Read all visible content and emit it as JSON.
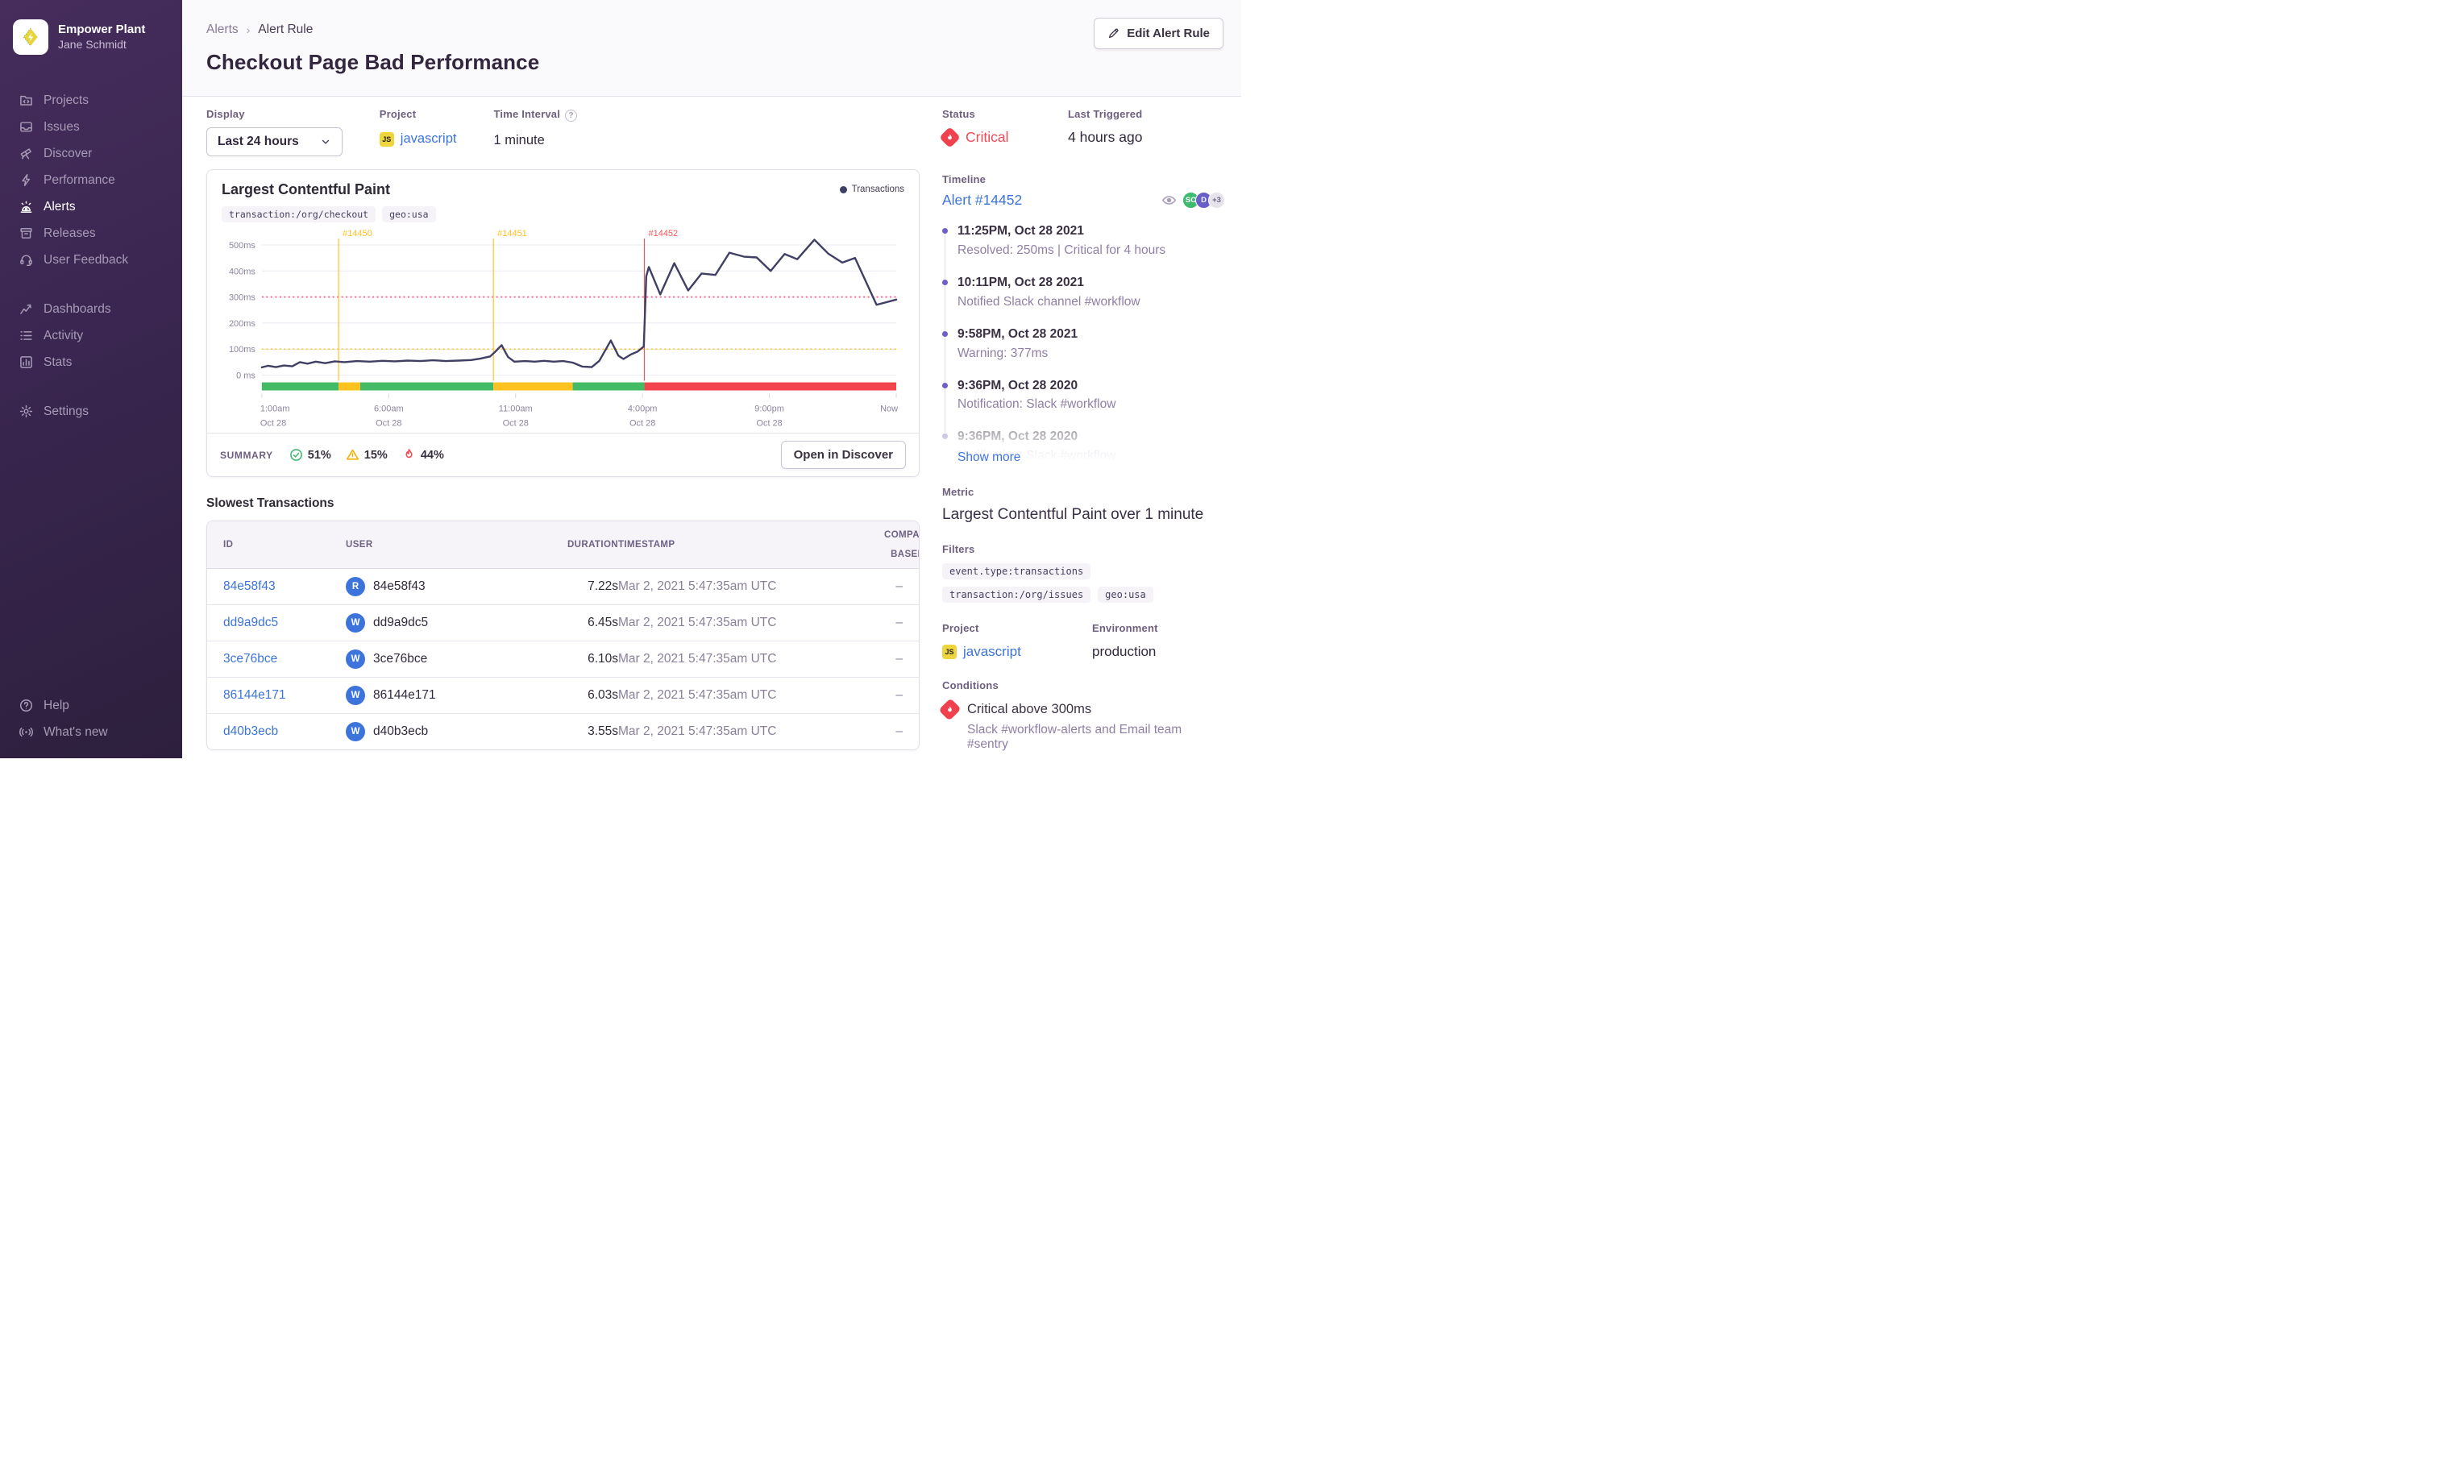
{
  "colors": {
    "ok": "#43ba64",
    "warning": "#fdc21f",
    "critical": "#f2454d",
    "line": "#3f3f63",
    "warning_line": "#ffc227",
    "critical_line": "#f55459",
    "threshold_critical": "#e9537e",
    "threshold_warning": "#ffc227",
    "grid": "#ece8f1",
    "axis": "#8d84a0",
    "accent_blue": "#3d74db",
    "status_red": "#f0414e"
  },
  "sidebar": {
    "org_name": "Empower Plant",
    "user_name": "Jane Schmidt",
    "sections": [
      {
        "name": "primary",
        "items": [
          {
            "label": "Projects",
            "icon": "projects"
          },
          {
            "label": "Issues",
            "icon": "issues"
          },
          {
            "label": "Discover",
            "icon": "discover"
          },
          {
            "label": "Performance",
            "icon": "performance"
          },
          {
            "label": "Alerts",
            "icon": "alerts",
            "active": true
          },
          {
            "label": "Releases",
            "icon": "releases"
          },
          {
            "label": "User Feedback",
            "icon": "user-feedback"
          }
        ]
      },
      {
        "name": "secondary",
        "items": [
          {
            "label": "Dashboards",
            "icon": "dashboards"
          },
          {
            "label": "Activity",
            "icon": "activity"
          },
          {
            "label": "Stats",
            "icon": "stats"
          }
        ]
      },
      {
        "name": "settings",
        "items": [
          {
            "label": "Settings",
            "icon": "settings"
          }
        ]
      }
    ],
    "footer_items": [
      {
        "label": "Help",
        "icon": "help"
      },
      {
        "label": "What's new",
        "icon": "whats-new"
      }
    ]
  },
  "header": {
    "breadcrumb_root": "Alerts",
    "breadcrumb_current": "Alert Rule",
    "title": "Checkout Page Bad Performance",
    "edit_button": "Edit Alert Rule"
  },
  "controls": {
    "display": {
      "label": "Display",
      "value": "Last 24 hours"
    },
    "project": {
      "label": "Project",
      "value": "javascript",
      "platform": "JS"
    },
    "interval": {
      "label": "Time Interval",
      "value": "1 minute"
    }
  },
  "status_panel": {
    "status_label": "Status",
    "status_value": "Critical",
    "last_triggered_label": "Last Triggered",
    "last_triggered_value": "4 hours ago"
  },
  "chart_card": {
    "title": "Largest Contentful Paint",
    "tags": [
      "transaction:/org/checkout",
      "geo:usa"
    ],
    "legend_label": "Transactions",
    "summary_label": "SUMMARY",
    "summary": [
      {
        "icon": "check-circle",
        "value": "51%"
      },
      {
        "icon": "warning-triangle",
        "value": "15%"
      },
      {
        "icon": "fire",
        "value": "44%"
      }
    ],
    "discover_button": "Open in Discover"
  },
  "chart_data": {
    "type": "line",
    "title": "Largest Contentful Paint",
    "unit": "ms",
    "ylim": [
      0,
      500
    ],
    "grid": true,
    "legend": {
      "position": "top-right",
      "entries": [
        "Transactions"
      ]
    },
    "y_ticks": [
      {
        "value": 0,
        "label": "0 ms"
      },
      {
        "value": 100,
        "label": "100ms"
      },
      {
        "value": 200,
        "label": "200ms"
      },
      {
        "value": 300,
        "label": "300ms"
      },
      {
        "value": 400,
        "label": "400ms"
      },
      {
        "value": 500,
        "label": "500ms"
      }
    ],
    "x_ticks": [
      {
        "pos": 0,
        "time": "1:00am",
        "date": "Oct 28"
      },
      {
        "pos": 0.2,
        "time": "6:00am",
        "date": "Oct 28"
      },
      {
        "pos": 0.4,
        "time": "11:00am",
        "date": "Oct 28"
      },
      {
        "pos": 0.6,
        "time": "4:00pm",
        "date": "Oct 28"
      },
      {
        "pos": 0.8,
        "time": "9:00pm",
        "date": "Oct 28"
      },
      {
        "pos": 1,
        "time": "Now",
        "date": ""
      }
    ],
    "thresholds": [
      {
        "label": "critical",
        "value": 300
      },
      {
        "label": "warning",
        "value": 100
      }
    ],
    "incidents": [
      {
        "id": "#14450",
        "pos": 0.121,
        "severity": "warning"
      },
      {
        "id": "#14451",
        "pos": 0.365,
        "severity": "warning"
      },
      {
        "id": "#14452",
        "pos": 0.603,
        "severity": "critical"
      }
    ],
    "status_segments": [
      {
        "from": 0,
        "to": 0.121,
        "status": "ok"
      },
      {
        "from": 0.121,
        "to": 0.155,
        "status": "warning"
      },
      {
        "from": 0.155,
        "to": 0.365,
        "status": "ok"
      },
      {
        "from": 0.365,
        "to": 0.49,
        "status": "warning"
      },
      {
        "from": 0.49,
        "to": 0.603,
        "status": "ok"
      },
      {
        "from": 0.603,
        "to": 1,
        "status": "critical"
      }
    ],
    "series": [
      {
        "name": "Transactions",
        "points": [
          [
            0,
            30
          ],
          [
            0.01,
            36
          ],
          [
            0.022,
            31
          ],
          [
            0.035,
            37
          ],
          [
            0.048,
            34
          ],
          [
            0.06,
            50
          ],
          [
            0.072,
            44
          ],
          [
            0.085,
            52
          ],
          [
            0.1,
            46
          ],
          [
            0.115,
            53
          ],
          [
            0.13,
            50
          ],
          [
            0.15,
            54
          ],
          [
            0.17,
            52
          ],
          [
            0.19,
            55
          ],
          [
            0.21,
            53
          ],
          [
            0.23,
            56
          ],
          [
            0.25,
            54
          ],
          [
            0.27,
            57
          ],
          [
            0.29,
            54
          ],
          [
            0.31,
            56
          ],
          [
            0.33,
            58
          ],
          [
            0.345,
            64
          ],
          [
            0.36,
            72
          ],
          [
            0.37,
            95
          ],
          [
            0.378,
            115
          ],
          [
            0.388,
            70
          ],
          [
            0.398,
            52
          ],
          [
            0.415,
            54
          ],
          [
            0.43,
            52
          ],
          [
            0.445,
            55
          ],
          [
            0.46,
            52
          ],
          [
            0.475,
            54
          ],
          [
            0.49,
            48
          ],
          [
            0.505,
            33
          ],
          [
            0.52,
            31
          ],
          [
            0.532,
            55
          ],
          [
            0.55,
            133
          ],
          [
            0.562,
            75
          ],
          [
            0.57,
            62
          ],
          [
            0.582,
            80
          ],
          [
            0.592,
            90
          ],
          [
            0.602,
            110
          ],
          [
            0.606,
            380
          ],
          [
            0.61,
            415
          ],
          [
            0.628,
            310
          ],
          [
            0.65,
            430
          ],
          [
            0.672,
            325
          ],
          [
            0.693,
            390
          ],
          [
            0.715,
            385
          ],
          [
            0.737,
            470
          ],
          [
            0.76,
            455
          ],
          [
            0.78,
            452
          ],
          [
            0.802,
            400
          ],
          [
            0.824,
            465
          ],
          [
            0.844,
            445
          ],
          [
            0.871,
            520
          ],
          [
            0.893,
            466
          ],
          [
            0.915,
            432
          ],
          [
            0.935,
            450
          ],
          [
            0.969,
            270
          ],
          [
            1,
            290
          ]
        ]
      }
    ]
  },
  "transactions_table": {
    "title": "Slowest Transactions",
    "columns": [
      "ID",
      "USER",
      "DURATION",
      "TIMESTAMP",
      "COMPARED TO BASELINE"
    ],
    "rows": [
      {
        "id": "84e58f43",
        "avatar": "R",
        "user": "84e58f43",
        "duration": "7.22s",
        "timestamp": "Mar 2, 2021 5:47:35am UTC",
        "baseline": "–"
      },
      {
        "id": "dd9a9dc5",
        "avatar": "W",
        "user": "dd9a9dc5",
        "duration": "6.45s",
        "timestamp": "Mar 2, 2021 5:47:35am UTC",
        "baseline": "–"
      },
      {
        "id": "3ce76bce",
        "avatar": "W",
        "user": "3ce76bce",
        "duration": "6.10s",
        "timestamp": "Mar 2, 2021 5:47:35am UTC",
        "baseline": "–"
      },
      {
        "id": "86144e171",
        "avatar": "W",
        "user": "86144e171",
        "duration": "6.03s",
        "timestamp": "Mar 2, 2021 5:47:35am UTC",
        "baseline": "–"
      },
      {
        "id": "d40b3ecb",
        "avatar": "W",
        "user": "d40b3ecb",
        "duration": "3.55s",
        "timestamp": "Mar 2, 2021 5:47:35am UTC",
        "baseline": "–"
      }
    ]
  },
  "timeline": {
    "label": "Timeline",
    "alert_link": "Alert #14452",
    "watchers": {
      "avatars": [
        "SC",
        "D"
      ],
      "more": "+3"
    },
    "entries": [
      {
        "time": "11:25PM, Oct 28 2021",
        "desc": "Resolved: 250ms | Critical for 4 hours"
      },
      {
        "time": "10:11PM, Oct 28 2021",
        "desc": "Notified Slack channel #workflow"
      },
      {
        "time": "9:58PM, Oct 28 2021",
        "desc": "Warning: 377ms"
      },
      {
        "time": "9:36PM, Oct 28 2020",
        "desc": "Notification: Slack #workflow"
      },
      {
        "time": "9:36PM, Oct 28 2020",
        "desc": "Notification: Slack #workflow",
        "faded": true
      }
    ],
    "show_more": "Show more"
  },
  "details": {
    "metric_label": "Metric",
    "metric_value": "Largest Contentful Paint over 1 minute",
    "filters_label": "Filters",
    "filter_chips": [
      "event.type:transactions",
      "transaction:/org/issues",
      "geo:usa"
    ],
    "project_label": "Project",
    "project_value": "javascript",
    "project_platform": "JS",
    "environment_label": "Environment",
    "environment_value": "production",
    "conditions_label": "Conditions",
    "condition_title": "Critical above 300ms",
    "condition_subtitle": "Slack #workflow-alerts and Email team #sentry"
  }
}
